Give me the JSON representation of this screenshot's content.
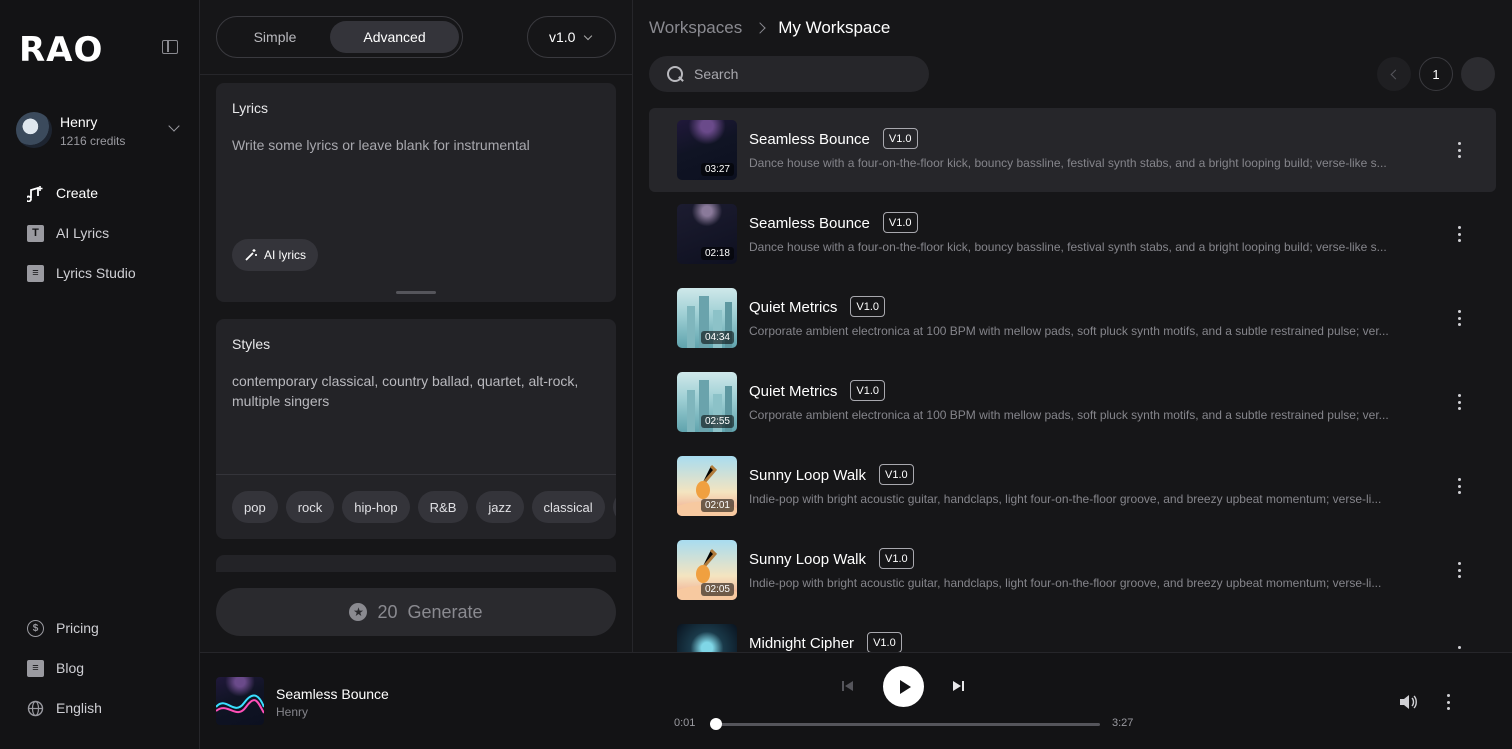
{
  "sidebar": {
    "logo": "RAO",
    "user": {
      "name": "Henry",
      "credits": "1216 credits"
    },
    "nav": [
      {
        "label": "Create",
        "icon": "create-music-icon"
      },
      {
        "label": "AI Lyrics",
        "icon": "text-t-icon"
      },
      {
        "label": "Lyrics Studio",
        "icon": "document-icon"
      }
    ],
    "bottom": [
      {
        "label": "Pricing",
        "icon": "dollar-icon"
      },
      {
        "label": "Blog",
        "icon": "blog-icon"
      },
      {
        "label": "English",
        "icon": "globe-icon"
      }
    ]
  },
  "create": {
    "modes": [
      "Simple",
      "Advanced"
    ],
    "active_mode": "Advanced",
    "version": "v1.0",
    "lyrics": {
      "title": "Lyrics",
      "placeholder": "Write some lyrics or leave blank for instrumental",
      "ai_button": "AI lyrics"
    },
    "styles": {
      "title": "Styles",
      "value": "contemporary classical, country ballad, quartet, alt-rock, multiple singers",
      "chips": [
        "pop",
        "rock",
        "hip-hop",
        "R&B",
        "jazz",
        "classical"
      ]
    },
    "generate": {
      "cost": "20",
      "label": "Generate"
    }
  },
  "workspace": {
    "breadcrumb": [
      "Workspaces",
      "My Workspace"
    ],
    "search_placeholder": "Search",
    "page": "1",
    "songs": [
      {
        "title": "Seamless Bounce",
        "version": "V1.0",
        "duration": "03:27",
        "desc": "Dance house with a four-on-the-floor kick, bouncy bassline, festival synth stabs, and a bright looping build; verse-like s...",
        "art": "art-bounce",
        "active": true
      },
      {
        "title": "Seamless Bounce",
        "version": "V1.0",
        "duration": "02:18",
        "desc": "Dance house with a four-on-the-floor kick, bouncy bassline, festival synth stabs, and a bright looping build; verse-like s...",
        "art": "art-bounce2",
        "active": false
      },
      {
        "title": "Quiet Metrics",
        "version": "V1.0",
        "duration": "04:34",
        "desc": "Corporate ambient electronica at 100 BPM with mellow pads, soft pluck synth motifs, and a subtle restrained pulse; ver...",
        "art": "art-quiet",
        "active": false
      },
      {
        "title": "Quiet Metrics",
        "version": "V1.0",
        "duration": "02:55",
        "desc": "Corporate ambient electronica at 100 BPM with mellow pads, soft pluck synth motifs, and a subtle restrained pulse; ver...",
        "art": "art-quiet",
        "active": false
      },
      {
        "title": "Sunny Loop Walk",
        "version": "V1.0",
        "duration": "02:01",
        "desc": "Indie-pop with bright acoustic guitar, handclaps, light four-on-the-floor groove, and breezy upbeat momentum; verse-li...",
        "art": "art-sunny",
        "active": false
      },
      {
        "title": "Sunny Loop Walk",
        "version": "V1.0",
        "duration": "02:05",
        "desc": "Indie-pop with bright acoustic guitar, handclaps, light four-on-the-floor groove, and breezy upbeat momentum; verse-li...",
        "art": "art-sunny",
        "active": false
      },
      {
        "title": "Midnight Cipher",
        "version": "V1.0",
        "duration": "",
        "desc": "",
        "art": "art-mid",
        "active": false
      }
    ]
  },
  "player": {
    "title": "Seamless Bounce",
    "artist": "Henry",
    "current": "0:01",
    "total": "3:27",
    "progress": 0.005
  }
}
